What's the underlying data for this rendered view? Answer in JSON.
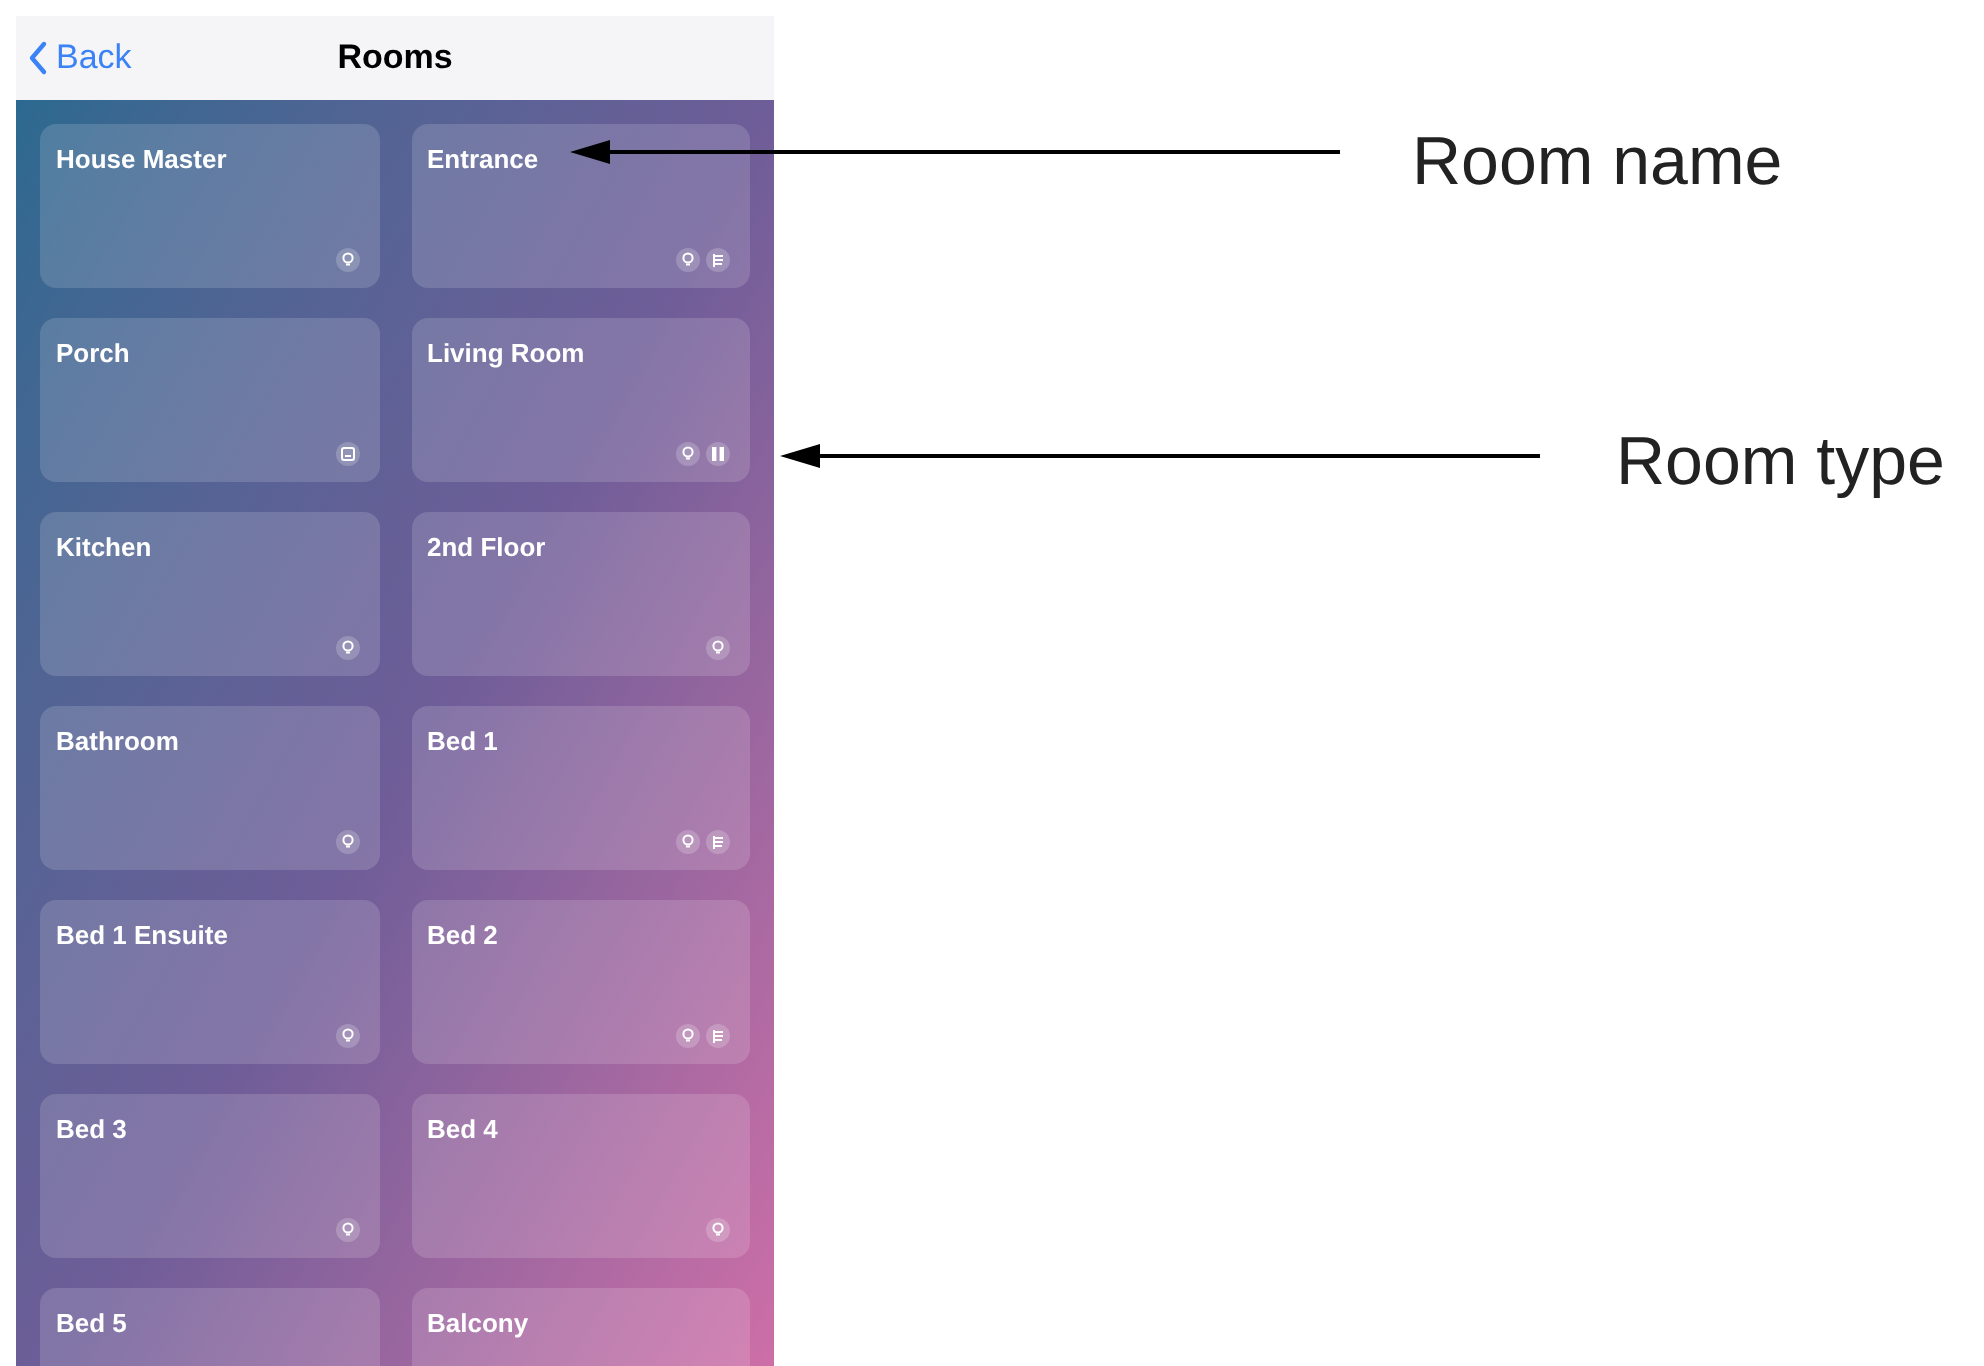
{
  "nav_bar": {
    "back": "Back",
    "title": "Rooms"
  },
  "rooms": [
    {
      "name": "House Master",
      "icons": [
        {
          "kind": "bulb"
        }
      ]
    },
    {
      "name": "Entrance",
      "icons": [
        {
          "kind": "bulb"
        },
        {
          "kind": "blinds"
        }
      ]
    },
    {
      "name": "Porch",
      "icons": [
        {
          "kind": "device"
        }
      ]
    },
    {
      "name": "Living Room",
      "icons": [
        {
          "kind": "bulb"
        },
        {
          "kind": "curtains"
        }
      ]
    },
    {
      "name": "Kitchen",
      "icons": [
        {
          "kind": "bulb"
        }
      ]
    },
    {
      "name": "2nd Floor",
      "icons": [
        {
          "kind": "bulb"
        }
      ]
    },
    {
      "name": "Bathroom",
      "icons": [
        {
          "kind": "bulb"
        }
      ]
    },
    {
      "name": "Bed 1",
      "icons": [
        {
          "kind": "bulb"
        },
        {
          "kind": "blinds"
        }
      ]
    },
    {
      "name": "Bed 1 Ensuite",
      "icons": [
        {
          "kind": "bulb"
        }
      ]
    },
    {
      "name": "Bed 2",
      "icons": [
        {
          "kind": "bulb"
        },
        {
          "kind": "blinds"
        }
      ]
    },
    {
      "name": "Bed 3",
      "icons": [
        {
          "kind": "bulb"
        }
      ]
    },
    {
      "name": "Bed 4",
      "icons": [
        {
          "kind": "bulb"
        }
      ]
    },
    {
      "name": "Bed 5"
    },
    {
      "name": "Balcony"
    }
  ],
  "annotations": [
    {
      "label": "Room name"
    },
    {
      "label": "Room type"
    }
  ]
}
